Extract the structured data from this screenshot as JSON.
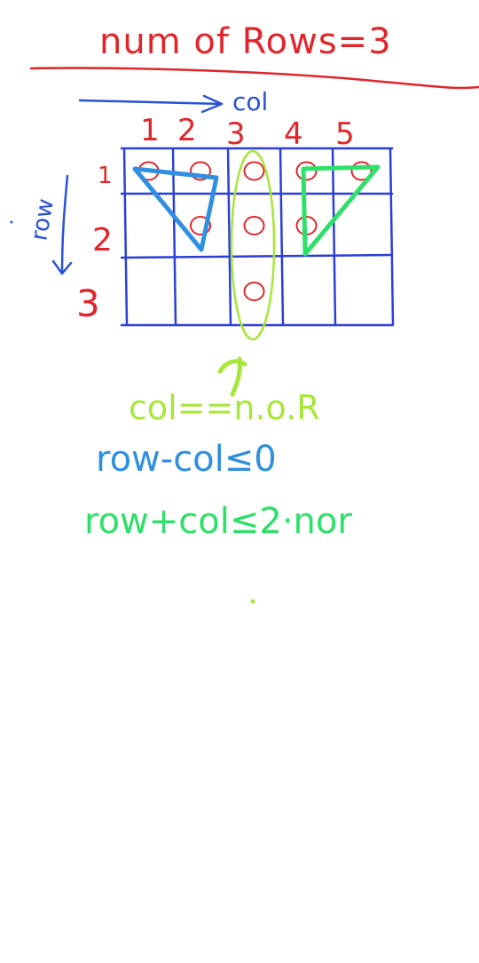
{
  "title": "num of Rows=3",
  "col_label": "col",
  "row_label": "row",
  "col_numbers": [
    "1",
    "2",
    "3",
    "4",
    "5"
  ],
  "row_numbers": [
    "1",
    "2",
    "3"
  ],
  "grid": {
    "rows": 3,
    "cols": 5,
    "circles": [
      {
        "row": 1,
        "col": 1
      },
      {
        "row": 1,
        "col": 2
      },
      {
        "row": 1,
        "col": 3
      },
      {
        "row": 1,
        "col": 4
      },
      {
        "row": 1,
        "col": 5
      },
      {
        "row": 2,
        "col": 2
      },
      {
        "row": 2,
        "col": 3
      },
      {
        "row": 2,
        "col": 4
      },
      {
        "row": 3,
        "col": 3
      }
    ]
  },
  "equations": {
    "middle": "col==n.o.R",
    "left": "row-col≤0",
    "right": "row+col≤2·nor"
  },
  "colors": {
    "red": "#e0252b",
    "blue": "#2a52d4",
    "grid_blue": "#2b3fd8",
    "sky_blue": "#2f8fe0",
    "green": "#2ee06a",
    "lime": "#a8e63a"
  }
}
